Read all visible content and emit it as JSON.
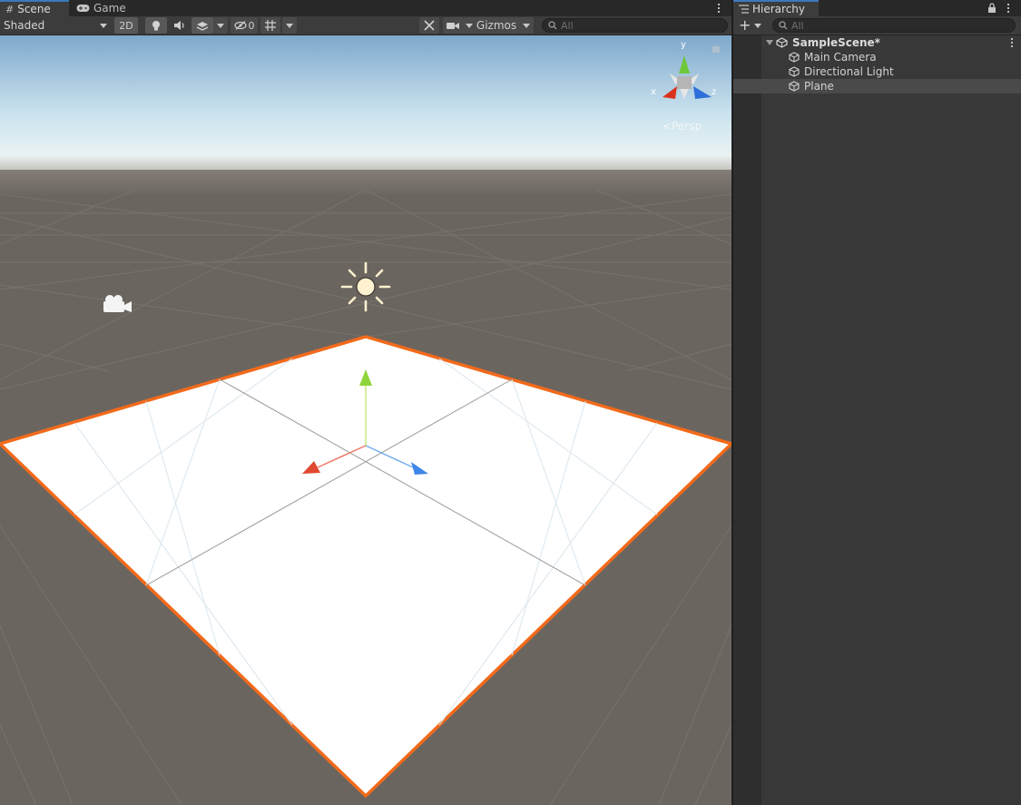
{
  "scene_tabs": {
    "scene_label": "Scene",
    "game_label": "Game"
  },
  "scene_toolbar": {
    "shading_mode": "Shaded",
    "toggle_2d_label": "2D",
    "hidden_count": "0",
    "gizmos_label": "Gizmos",
    "search_placeholder": "All"
  },
  "viewport": {
    "projection_label": "Persp",
    "gizmo_axes": {
      "x": "x",
      "y": "y",
      "z": "z"
    },
    "sky_color_top": "#7fa8cc",
    "ground_color": "#6b6560",
    "selection_outline_color": "#f26a1b"
  },
  "hierarchy": {
    "tab_label": "Hierarchy",
    "search_placeholder": "All",
    "scene_name": "SampleScene*",
    "items": [
      {
        "label": "Main Camera",
        "selected": false
      },
      {
        "label": "Directional Light",
        "selected": false
      },
      {
        "label": "Plane",
        "selected": true
      }
    ]
  }
}
